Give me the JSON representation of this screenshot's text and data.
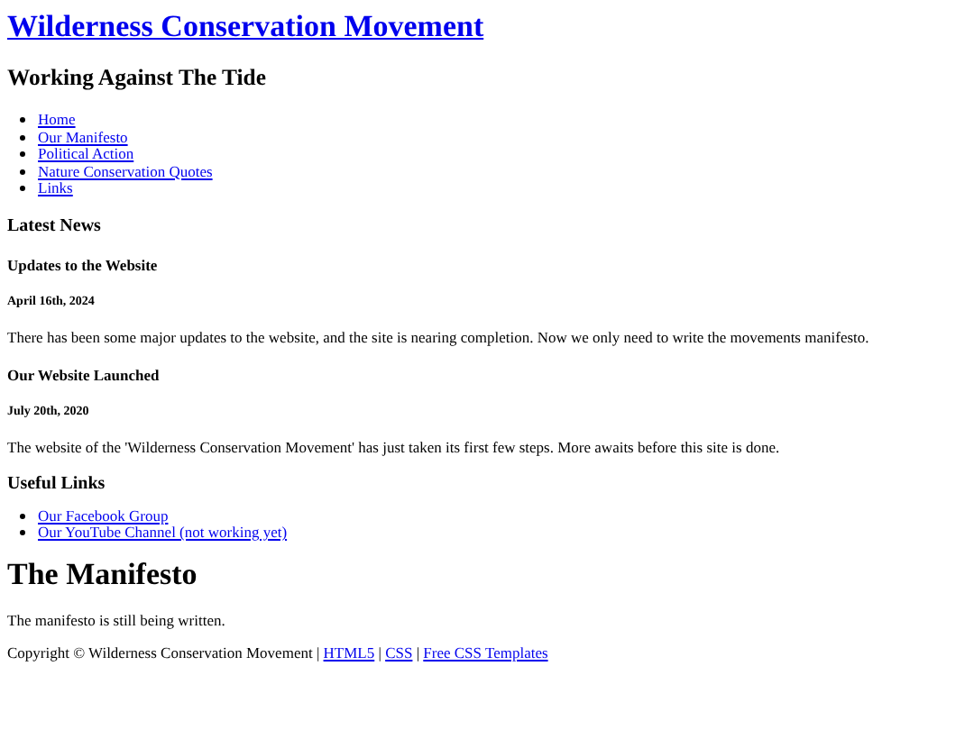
{
  "site_title": "Wilderness Conservation Movement",
  "tagline": "Working Against The Tide",
  "nav": [
    "Home",
    "Our Manifesto",
    "Political Action",
    "Nature Conservation Quotes",
    "Links"
  ],
  "news": {
    "heading": "Latest News",
    "items": [
      {
        "title": "Updates to the Website",
        "date": "April 16th, 2024",
        "body": "There has been some major updates to the website, and the site is nearing completion. Now we only need to write the movements manifesto."
      },
      {
        "title": "Our Website Launched",
        "date": "July 20th, 2020",
        "body": "The website of the 'Wilderness Conservation Movement' has just taken its first few steps. More awaits before this site is done."
      }
    ]
  },
  "useful_links": {
    "heading": "Useful Links",
    "items": [
      "Our Facebook Group",
      "Our YouTube Channel (not working yet)"
    ]
  },
  "main": {
    "heading": "The Manifesto",
    "body": "The manifesto is still being written."
  },
  "footer": {
    "text": "Copyright © Wilderness Conservation Movement",
    "separator": "|",
    "links": [
      "HTML5",
      "CSS",
      "Free CSS Templates"
    ]
  }
}
